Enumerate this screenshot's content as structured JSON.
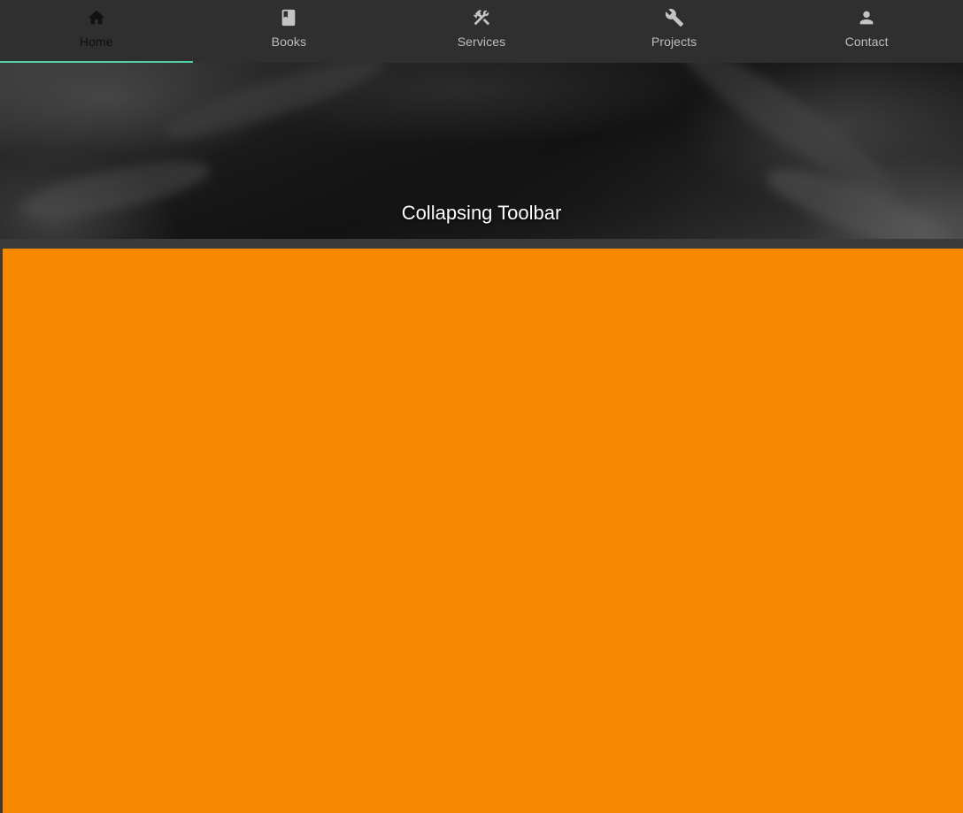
{
  "nav": {
    "tabs": [
      {
        "label": "Home",
        "icon": "home-icon",
        "active": true
      },
      {
        "label": "Books",
        "icon": "book-icon",
        "active": false
      },
      {
        "label": "Services",
        "icon": "tools-icon",
        "active": false
      },
      {
        "label": "Projects",
        "icon": "wrench-icon",
        "active": false
      },
      {
        "label": "Contact",
        "icon": "person-icon",
        "active": false
      }
    ],
    "indicator_color": "#4fd1a5"
  },
  "toolbar": {
    "title": "Collapsing Toolbar"
  },
  "content": {
    "background_color": "#f78900"
  }
}
